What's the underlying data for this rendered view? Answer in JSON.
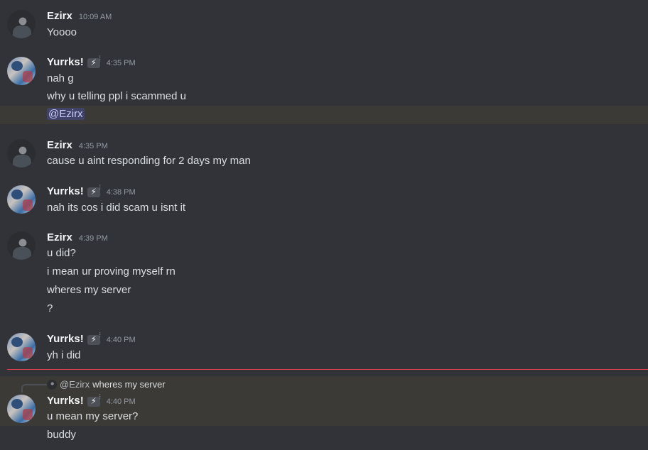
{
  "users": {
    "ezirx": {
      "name": "Ezirx"
    },
    "yurrks": {
      "name": "Yurrks!",
      "tag": "⚡"
    }
  },
  "messages": [
    {
      "author": "Ezirx",
      "time": "10:09 AM",
      "lines": [
        "Yoooo"
      ]
    },
    {
      "author": "Yurrks!",
      "time": "4:35 PM",
      "lines": [
        "nah g",
        "why u telling ppl i scammed u"
      ],
      "mention": "@Ezirx"
    },
    {
      "author": "Ezirx",
      "time": "4:35 PM",
      "lines": [
        "cause u aint responding for 2 days my man"
      ]
    },
    {
      "author": "Yurrks!",
      "time": "4:38 PM",
      "lines": [
        "nah its cos i did scam u isnt it"
      ]
    },
    {
      "author": "Ezirx",
      "time": "4:39 PM",
      "lines": [
        "u did?",
        "i mean ur proving myself rn",
        "wheres my server",
        "?"
      ]
    },
    {
      "author": "Yurrks!",
      "time": "4:40 PM",
      "lines": [
        "yh i did"
      ]
    },
    {
      "author": "Yurrks!",
      "time": "4:40 PM",
      "reply": {
        "name": "@Ezirx",
        "text": "wheres my server"
      },
      "lines": [
        "u mean my server?",
        "buddy"
      ]
    }
  ],
  "colors": {
    "background": "#313338",
    "mention_bg": "#414468",
    "mention_text": "#c9cdfb",
    "highlight_row": "#3b3a37",
    "new_divider": "#e0434d"
  }
}
